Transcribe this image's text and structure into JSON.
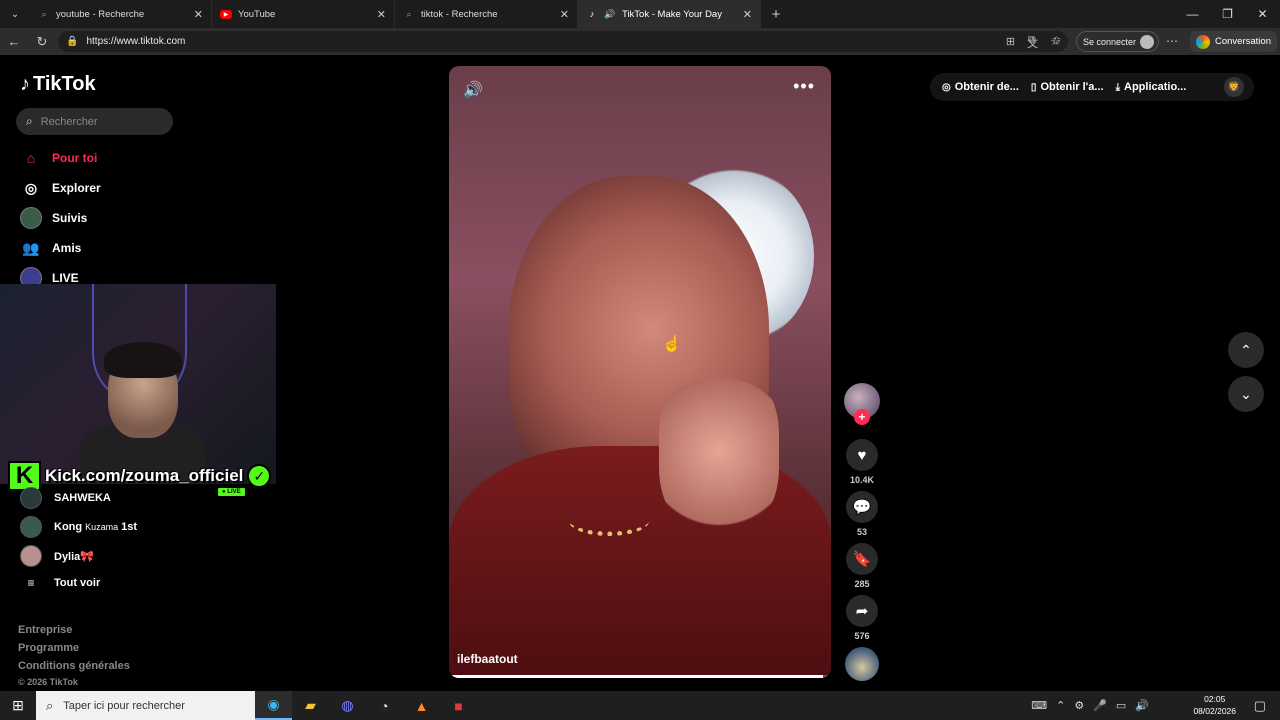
{
  "browser": {
    "tabs": [
      {
        "title": "youtube - Recherche",
        "icon": "search-icon"
      },
      {
        "title": "YouTube",
        "icon": "youtube-icon"
      },
      {
        "title": "tiktok - Recherche",
        "icon": "search-icon"
      },
      {
        "title": "TikTok - Make Your Day",
        "icon": "tiktok-icon",
        "active": true
      }
    ],
    "url": "https://www.tiktok.com",
    "signin_label": "Se connecter",
    "conversation_label": "Conversation"
  },
  "tiktok": {
    "brand": "TikTok",
    "search_placeholder": "Rechercher",
    "menu": [
      {
        "label": "Pour toi",
        "icon": "home-icon"
      },
      {
        "label": "Explorer",
        "icon": "compass-icon"
      },
      {
        "label": "Suivis",
        "icon": "following-icon"
      },
      {
        "label": "Amis",
        "icon": "friends-icon"
      },
      {
        "label": "LIVE",
        "icon": "live-icon"
      }
    ],
    "following": [
      {
        "name": "SAHWEKA",
        "sub": ""
      },
      {
        "name": "Kong",
        "sub": "Kuzama",
        "suffix": "1st"
      },
      {
        "name": "Dylia🎀",
        "sub": ""
      }
    ],
    "see_all": "Tout voir",
    "footer": [
      "Entreprise",
      "Programme",
      "Conditions générales"
    ],
    "copyright": "© 2026 TikTok",
    "top_buttons": [
      "Obtenir de...",
      "Obtenir l'a...",
      "Applicatio..."
    ],
    "video": {
      "author": "ilefbaatout",
      "likes": "10.4K",
      "comments": "53",
      "bookmarks": "285",
      "shares": "576",
      "progress": 0.98
    }
  },
  "overlay": {
    "kick_text": "Kick.com/zouma_officiel",
    "live_label": "LIVE",
    "kick_letter": "K"
  },
  "taskbar": {
    "search_placeholder": "Taper ici pour rechercher",
    "time": "02:05",
    "date": "08/02/2026"
  }
}
